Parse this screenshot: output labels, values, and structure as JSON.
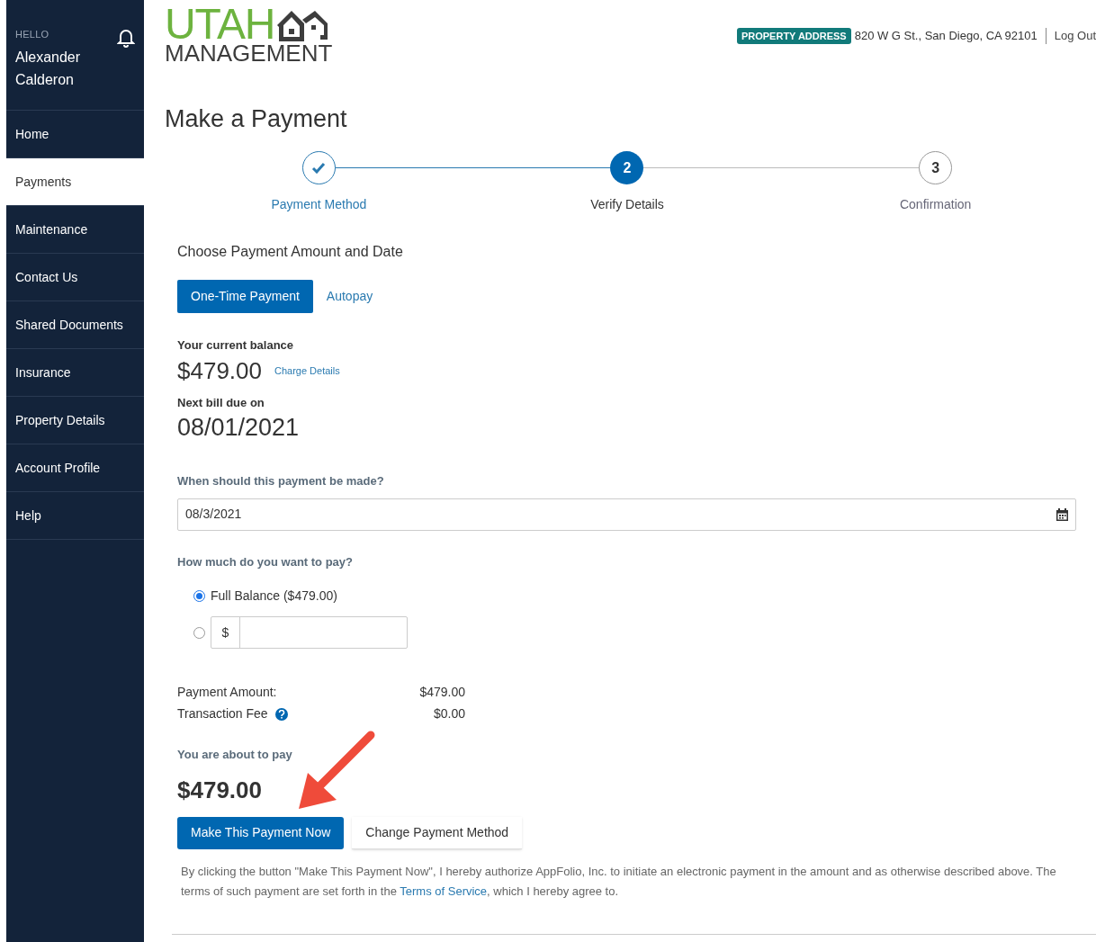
{
  "sidebar": {
    "greeting": "HELLO",
    "user_name": "Alexander Calderon",
    "items": [
      {
        "label": "Home",
        "selected": false
      },
      {
        "label": "Payments",
        "selected": true
      },
      {
        "label": "Maintenance",
        "selected": false
      },
      {
        "label": "Contact Us",
        "selected": false
      },
      {
        "label": "Shared Documents",
        "selected": false
      },
      {
        "label": "Insurance",
        "selected": false
      },
      {
        "label": "Property Details",
        "selected": false
      },
      {
        "label": "Account Profile",
        "selected": false
      },
      {
        "label": "Help",
        "selected": false
      }
    ]
  },
  "header": {
    "logo_top": "UTAH",
    "logo_bottom": "MANAGEMENT",
    "property_badge": "PROPERTY ADDRESS",
    "property_address": "820 W G St., San Diego, CA 92101",
    "logout": "Log Out"
  },
  "page_title": "Make a Payment",
  "steps": [
    {
      "label": "Payment Method",
      "kind": "done"
    },
    {
      "label": "Verify Details",
      "kind": "current",
      "number": "2"
    },
    {
      "label": "Confirmation",
      "kind": "upcoming",
      "number": "3"
    }
  ],
  "section_title": "Choose Payment Amount and Date",
  "tabs": [
    {
      "label": "One-Time Payment",
      "selected": true
    },
    {
      "label": "Autopay",
      "selected": false
    }
  ],
  "balance": {
    "label": "Your current balance",
    "amount": "$479.00",
    "link": "Charge Details"
  },
  "due": {
    "label": "Next bill due on",
    "date": "08/01/2021"
  },
  "date_field": {
    "label": "When should this payment be made?",
    "value": "08/3/2021"
  },
  "amount": {
    "label": "How much do you want to pay?",
    "options": [
      {
        "kind": "full",
        "label": "Full Balance ($479.00)",
        "selected": true
      },
      {
        "kind": "custom",
        "prefix": "$",
        "selected": false
      }
    ]
  },
  "summary": [
    {
      "label": "Payment Amount:",
      "value": "$479.00",
      "help": false
    },
    {
      "label": "Transaction Fee",
      "value": "$0.00",
      "help": true
    }
  ],
  "total": {
    "label": "You are about to pay",
    "amount": "$479.00"
  },
  "buttons": [
    {
      "label": "Make This Payment Now",
      "kind": "primary"
    },
    {
      "label": "Change Payment Method",
      "kind": "secondary"
    }
  ],
  "disclaimer": {
    "before": "By clicking the button \"Make This Payment Now\", I hereby authorize AppFolio, Inc. to initiate an electronic payment in the amount and as otherwise described above. The terms of such payment are set forth in the",
    "link": "Terms of Service",
    "after": ", which I hereby agree to."
  }
}
